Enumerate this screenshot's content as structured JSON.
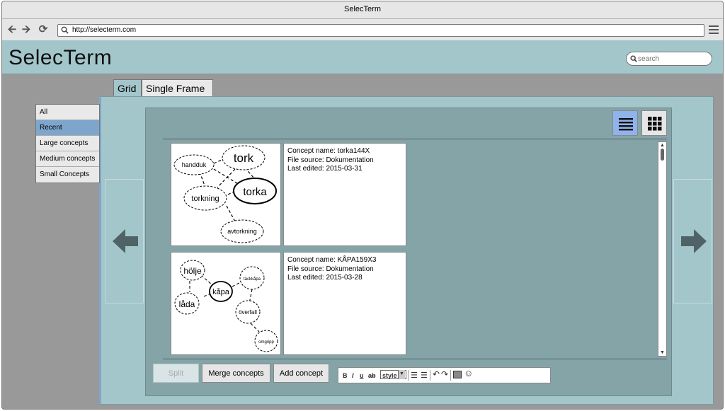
{
  "window": {
    "title": "SelecTerm"
  },
  "browser": {
    "url": "http://selecterm.com"
  },
  "app": {
    "title": "SelecTerm",
    "search_placeholder": "search"
  },
  "tabs": [
    {
      "label": "Grid",
      "active": true
    },
    {
      "label": "Single Frame",
      "active": false
    }
  ],
  "filters": [
    {
      "label": "All",
      "active": false
    },
    {
      "label": "Recent",
      "active": true
    },
    {
      "label": "Large concepts",
      "active": false
    },
    {
      "label": "Medium concepts",
      "active": false
    },
    {
      "label": "Small Concepts",
      "active": false
    }
  ],
  "concepts": [
    {
      "name_line": "Concept name: torka144X",
      "source_line": "File source: Dokumentation",
      "edited_line": "Last edited: 2015-03-31",
      "diagram": {
        "nodes": [
          "tork",
          "handduk",
          "torka",
          "torkning",
          "avtorkning"
        ]
      }
    },
    {
      "name_line": "Concept name: KÅPA159X3",
      "source_line": "File source: Dokumentation",
      "edited_line": "Last edited: 2015-03-28",
      "diagram": {
        "nodes": [
          "hölje",
          "kåpa",
          "täckkåpa",
          "låda",
          "överfall",
          "omgripp"
        ]
      }
    }
  ],
  "actions": {
    "split": "Split",
    "merge": "Merge concepts",
    "add": "Add concept"
  },
  "editor": {
    "bold": "B",
    "italic": "I",
    "underline": "u",
    "strike": "ab",
    "style": "style"
  },
  "colors": {
    "header_bg": "#a3c6cb",
    "panel_bg": "#85a4a8",
    "active_filter": "#7ea6cd",
    "active_view_button": "#8fb3ea"
  }
}
